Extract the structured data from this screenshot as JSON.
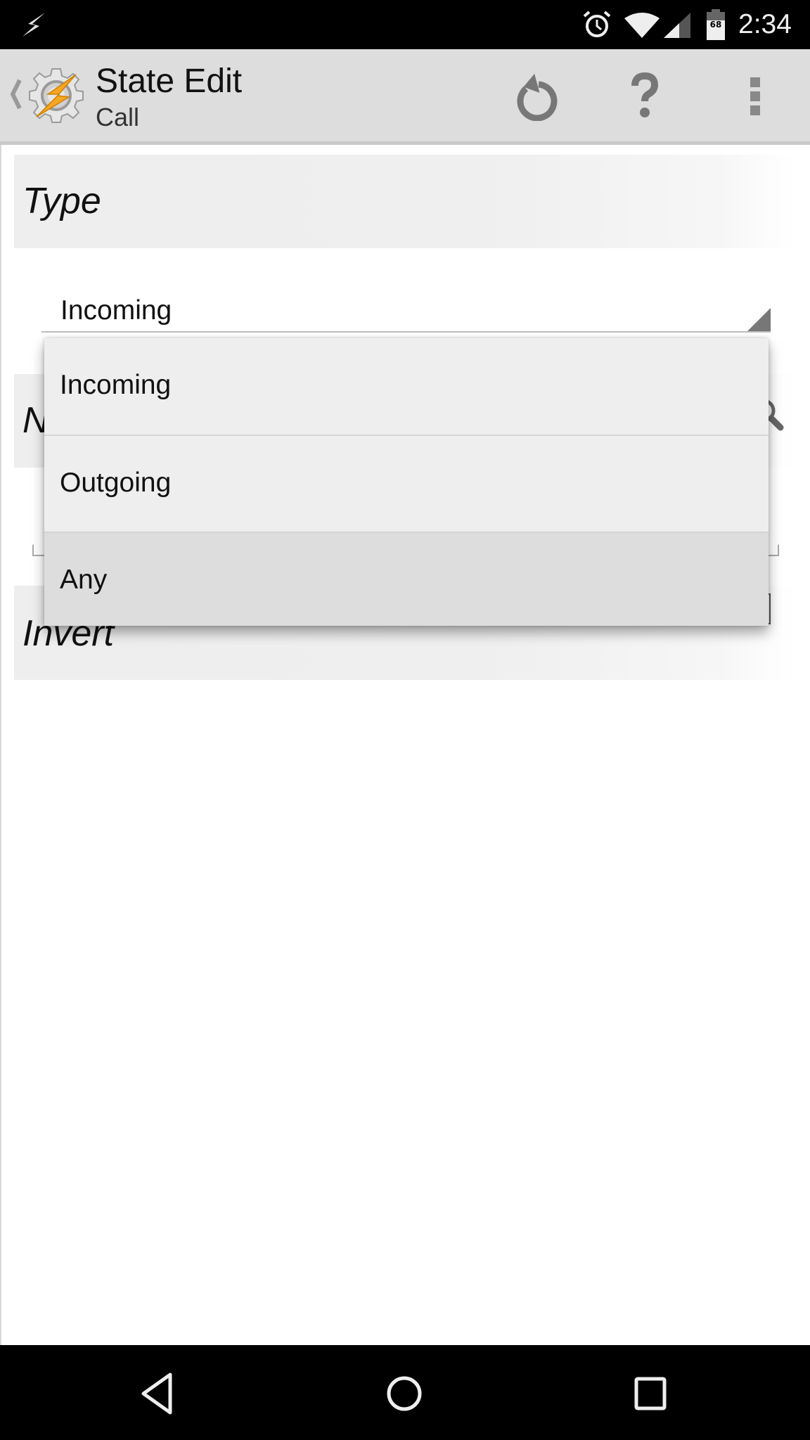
{
  "status_bar": {
    "notification_icon": "bolt-icon",
    "icons": [
      "alarm-icon",
      "wifi-icon",
      "signal-icon",
      "battery-icon"
    ],
    "battery_level": "68",
    "time": "2:34"
  },
  "action_bar": {
    "title": "State Edit",
    "subtitle": "Call",
    "app_icon": "tasker-gear-bolt-icon",
    "actions": [
      {
        "name": "undo",
        "icon": "undo-icon"
      },
      {
        "name": "help",
        "icon": "help-icon",
        "glyph": "?"
      },
      {
        "name": "more",
        "icon": "overflow-menu-icon"
      }
    ]
  },
  "sections": {
    "type": {
      "title": "Type",
      "spinner_value": "Incoming"
    },
    "number": {
      "title_visible": "N",
      "icon": "search-icon",
      "field_value": ""
    },
    "invert": {
      "title": "Invert",
      "checked": false
    }
  },
  "dropdown": {
    "options": [
      "Incoming",
      "Outgoing",
      "Any"
    ],
    "highlighted": "Any"
  },
  "nav_bar": {
    "buttons": [
      "back",
      "home",
      "recents"
    ]
  },
  "colors": {
    "action_bar_bg": "#dddddd",
    "icon_gray": "#777777",
    "app_icon_bolt": "#f5a623",
    "dropdown_bg": "#eeeeee",
    "dropdown_highlight": "#dddddd"
  }
}
